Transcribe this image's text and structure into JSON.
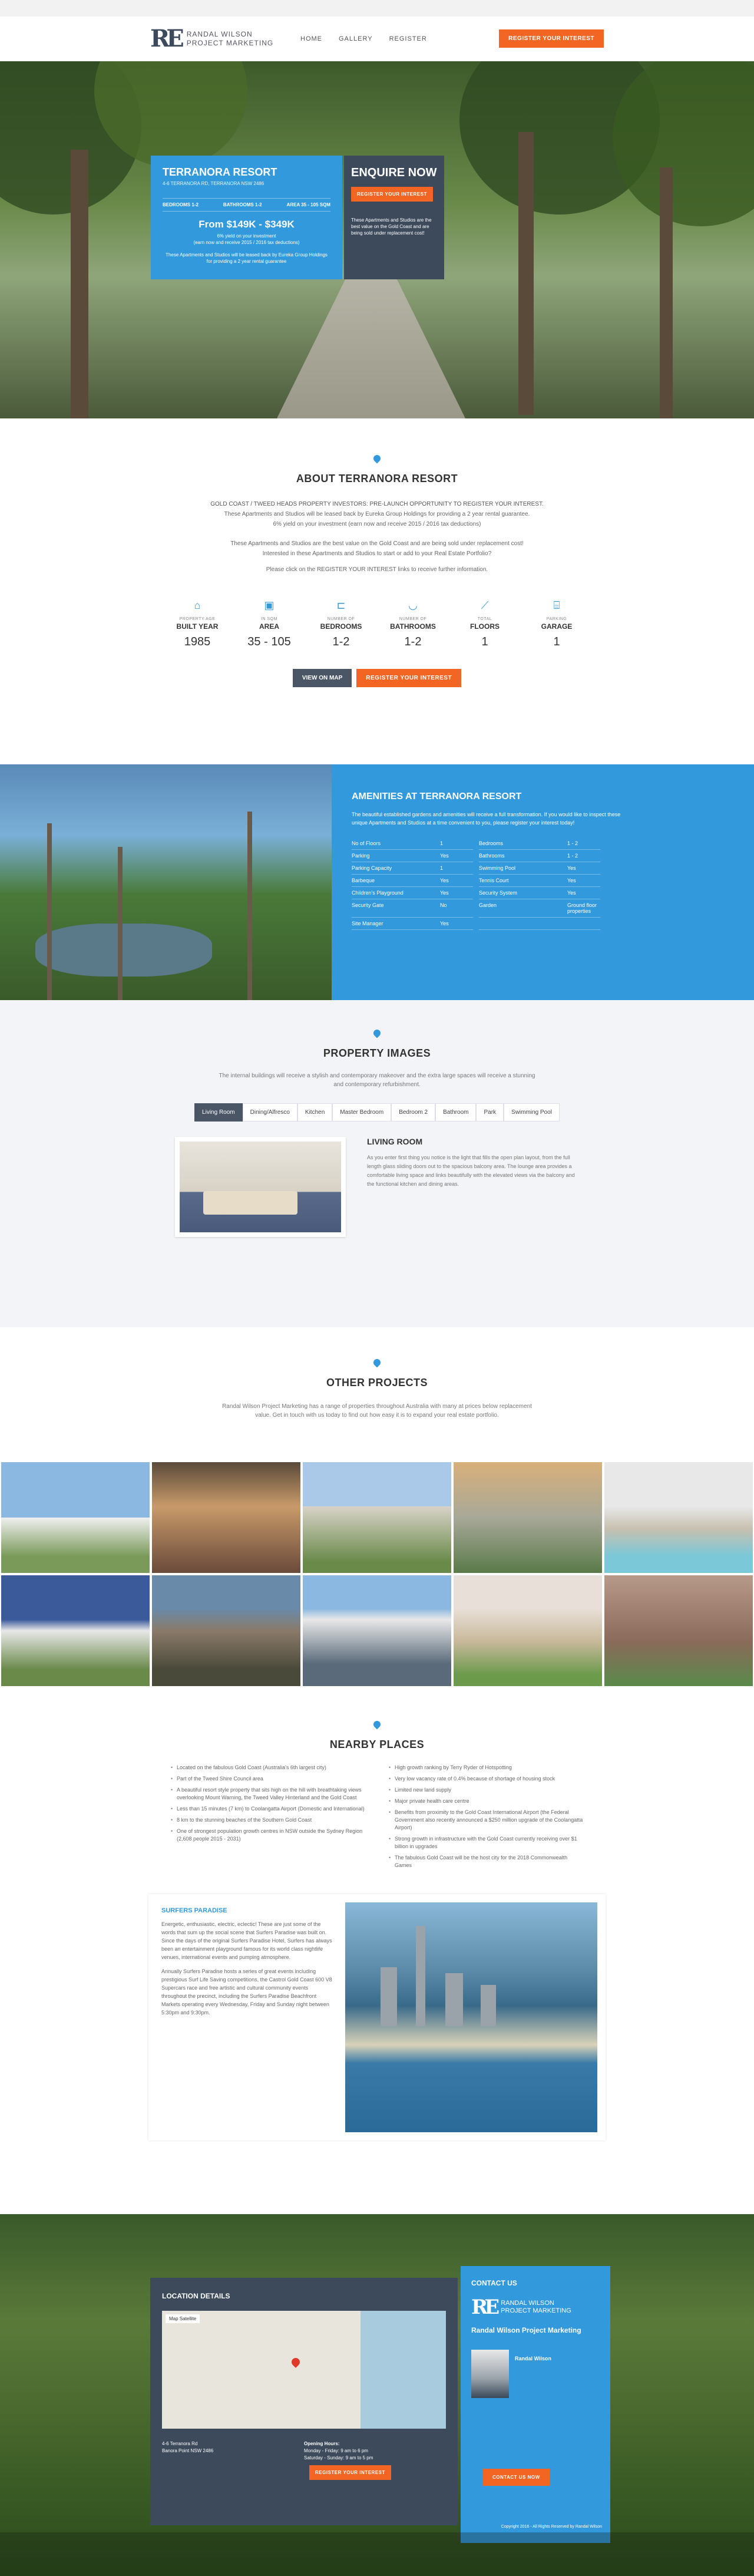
{
  "header": {
    "logo_text_1": "RANDAL WILSON",
    "logo_text_2": "PROJECT MARKETING",
    "nav": [
      "HOME",
      "GALLERY",
      "REGISTER"
    ],
    "cta": "REGISTER YOUR INTEREST"
  },
  "hero": {
    "title": "TERRANORA RESORT",
    "address": "4-6 TERRANORA RD, TERRANORA NSW 2486",
    "stats": [
      "BEDROOMS 1-2",
      "BATHROOMS 1-2",
      "AREA 35 - 105 SQM"
    ],
    "price": "From $149K - $349K",
    "yield_1": "6% yield on your investment",
    "yield_2": "(earn now and receive 2015 / 2016 tax deductions)",
    "note": "These Apartments and Studios will be leased back by Eureka Group Holdings for providing a 2 year rental guarantee",
    "enquire_title": "ENQUIRE NOW",
    "enquire_btn": "REGISTER YOUR INTEREST",
    "enquire_note": "These Apartments and Studios are the best value on the Gold Coast and are being sold under replacement cost!"
  },
  "about": {
    "title": "ABOUT TERRANORA RESORT",
    "intro_1": "GOLD COAST / TWEED HEADS PROPERTY INVESTORS: PRE-LAUNCH OPPORTUNITY TO REGISTER YOUR INTEREST.",
    "intro_2": "These Apartments and Studios will be leased back by Eureka Group Holdings for providing a 2 year rental guarantee.",
    "intro_3": "6% yield on your investment (earn now and receive 2015 / 2016 tax deductions)",
    "para_1": "These Apartments and Studios are the best value on the Gold Coast and are being sold under replacement cost!",
    "para_2": "Interested in these Apartments and Studios to start or add to your Real Estate Portfolio?",
    "para_3": "Please click on the REGISTER YOUR INTEREST links to receive further information.",
    "features": [
      {
        "icon": "building-icon",
        "glyph": "⌂",
        "top": "PROPERTY AGE",
        "label": "BUILT YEAR",
        "value": "1985"
      },
      {
        "icon": "area-icon",
        "glyph": "▣",
        "top": "IN SQM",
        "label": "AREA",
        "value": "35 - 105"
      },
      {
        "icon": "bed-icon",
        "glyph": "⊏",
        "top": "NUMBER OF",
        "label": "BEDROOMS",
        "value": "1-2"
      },
      {
        "icon": "bath-icon",
        "glyph": "◡",
        "top": "NUMBER OF",
        "label": "BATHROOMS",
        "value": "1-2"
      },
      {
        "icon": "stairs-icon",
        "glyph": "⟋",
        "top": "TOTAL",
        "label": "FLOORS",
        "value": "1"
      },
      {
        "icon": "garage-icon",
        "glyph": "⌸",
        "top": "PARKING",
        "label": "GARAGE",
        "value": "1"
      }
    ],
    "map_btn": "VIEW ON MAP",
    "register_btn": "REGISTER YOUR INTEREST"
  },
  "amenities": {
    "title": "AMENITIES AT TERRANORA RESORT",
    "desc": "The beautiful established gardens and amenities will receive a full transformation. If you would like to inspect these unique Apartments and Studios at a time convenient to you, please register your interest today!",
    "rows": [
      [
        "No of Floors",
        "1",
        "Bedrooms",
        "1 - 2"
      ],
      [
        "Parking",
        "Yes",
        "Bathrooms",
        "1 - 2"
      ],
      [
        "Parking Capacity",
        "1",
        "Swimming Pool",
        "Yes"
      ],
      [
        "Barbeque",
        "Yes",
        "Tennis Court",
        "Yes"
      ],
      [
        "Children's Playground",
        "Yes",
        "Security System",
        "Yes"
      ],
      [
        "Security Gate",
        "No",
        "Garden",
        "Ground floor properties"
      ],
      [
        "Site Manager",
        "Yes",
        "",
        ""
      ]
    ]
  },
  "images": {
    "title": "PROPERTY IMAGES",
    "sub_1": "The internal buildings will receive a stylish and contemporary makeover and the extra large spaces will receive a stunning",
    "sub_2": "and contemporary refurbishment.",
    "tabs": [
      "Living Room",
      "Dining/Alfresco",
      "Kitchen",
      "Master Bedroom",
      "Bedroom 2",
      "Bathroom",
      "Park",
      "Swimming Pool"
    ],
    "room_title": "LIVING ROOM",
    "room_desc": "As you enter first thing you notice is the light that fills the open plan layout, from the full length glass sliding doors out to the spacious balcony area. The lounge area provides a comfortable living space and links beautifully with the elevated views via the balcony and the functional kitchen and dining areas."
  },
  "other": {
    "title": "OTHER PROJECTS",
    "sub_1": "Randal Wilson Project Marketing has a range of properties throughout Australia with many at prices below replacement",
    "sub_2": "value. Get in touch with us today to find out how easy it is to expand your real estate portfolio."
  },
  "nearby": {
    "title": "NEARBY PLACES",
    "left": [
      "Located on the fabulous Gold Coast (Australia's 6th largest city)",
      "Part of the Tweed Shire Council area",
      "A beautiful resort style property that sits high on the hill with breathtaking views overlooking Mount Warning, the Tweed Valley Hinterland and the Gold Coast",
      "Less than 15 minutes (7 km) to Coolangatta Airport (Domestic and International)",
      "8 km to the stunning beaches of the Southern Gold Coast",
      "One of strongest population growth centres in NSW outside the Sydney Region (2,608 people 2015 - 2031)"
    ],
    "right": [
      "High growth ranking by Terry Ryder of Hotspotting",
      "Very low vacancy rate of 0.4% because of shortage of housing stock",
      "Limited new land supply",
      "Major private health care centre",
      "Benefits from proximity to the Gold Coast International Airport (the Federal Government also recently announced a $250 million upgrade of the Coolangatta Airport)",
      "Strong growth in infrastructure with the Gold Coast currently receiving over $1 billion in upgrades",
      "The fabulous Gold Coast will be the host city for the 2018 Commonwealth Games"
    ],
    "surfers_title": "SURFERS PARADISE",
    "surfers_p1": "Energetic, enthusiastic, electric, eclectic! These are just some of the words that sum up the social scene that Surfers Paradise was built on. Since the days of the original Surfers Paradise Hotel, Surfers has always been an entertainment playground famous for its world class nightlife venues, international events and pumping atmosphere.",
    "surfers_p2": "Annually Surfers Paradise hosts a series of great events including prestigious Surf Life Saving competitions, the Castrol Gold Coast 600 V8 Supercars race and free artistic and cultural community events throughout the precinct, including the Surfers Paradise Beachfront Markets operating every Wednesday, Friday and Sunday night between 5:30pm and 9:30pm."
  },
  "location": {
    "title": "LOCATION DETAILS",
    "map_tabs": "Map   Satellite",
    "address_1": "4-6 Terranora Rd",
    "address_2": "Banora Point NSW 2486",
    "hours_title": "Opening Hours:",
    "hours_1": "Monday - Friday: 9 am to 6 pm",
    "hours_2": "Saturday - Sunday: 9 am to 5 pm",
    "register_btn": "REGISTER YOUR INTEREST"
  },
  "contact": {
    "title": "CONTACT US",
    "logo_1": "RANDAL WILSON",
    "logo_2": "PROJECT MARKETING",
    "company": "Randal Wilson Project Marketing",
    "agent": "Randal Wilson",
    "btn": "CONTACT US NOW",
    "copyright": "Copyright 2016 - All Rights Reserved by Randal Wilson"
  },
  "colors": {
    "accent": "#3399dd",
    "cta": "#f26522",
    "dark": "#3c4a5c"
  }
}
